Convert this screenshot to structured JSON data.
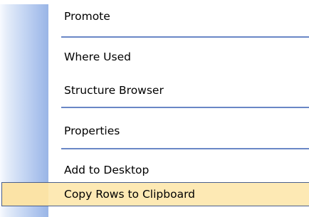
{
  "context_menu": {
    "items": [
      {
        "label": "Promote"
      },
      {
        "label": "Where Used"
      },
      {
        "label": "Structure Browser"
      },
      {
        "label": "Properties"
      },
      {
        "label": "Add to Desktop"
      },
      {
        "label": "Copy Rows to Clipboard",
        "selected": true
      }
    ]
  },
  "colors": {
    "gutter": "#99b5e6",
    "separator": "#6a87c6",
    "highlight": "#fde9b4",
    "highlight_border": "#4a5f8c"
  }
}
